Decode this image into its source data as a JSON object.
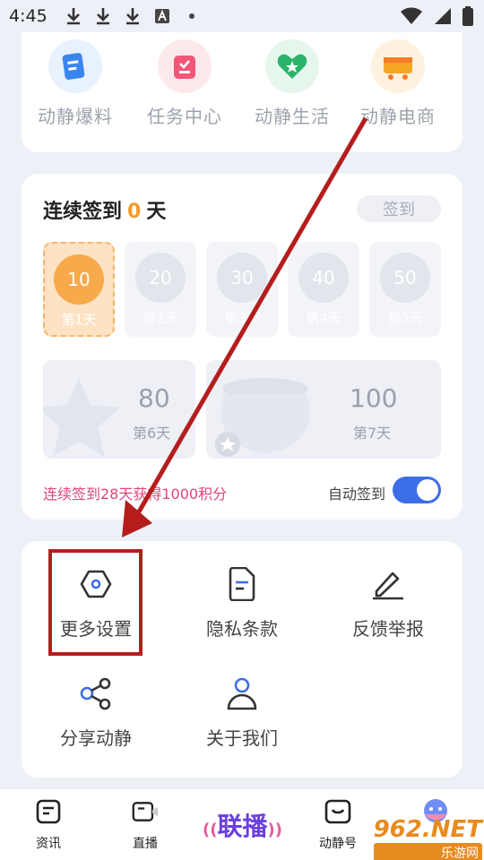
{
  "statusbar": {
    "time": "4:45"
  },
  "quick_entries": [
    {
      "label": "动静爆料",
      "icon": "news-doc-icon",
      "color": "#3a86f0",
      "bg": "#e8f2fe"
    },
    {
      "label": "任务中心",
      "icon": "task-board-icon",
      "color": "#f35677",
      "bg": "#fde9ec"
    },
    {
      "label": "动静生活",
      "icon": "heart-star-icon",
      "color": "#2bb36b",
      "bg": "#e5f7ec"
    },
    {
      "label": "动静电商",
      "icon": "shop-cart-icon",
      "color": "#f5a623",
      "bg": "#fff1df"
    }
  ],
  "checkin": {
    "title_prefix": "连续签到",
    "days_count": "0",
    "title_suffix": "天",
    "button_label": "签到",
    "days": [
      {
        "points": "10",
        "label": "第1天"
      },
      {
        "points": "20",
        "label": "第2天"
      },
      {
        "points": "30",
        "label": "第3天"
      },
      {
        "points": "40",
        "label": "第4天"
      },
      {
        "points": "50",
        "label": "第5天"
      }
    ],
    "big_days": [
      {
        "points": "80",
        "label": "第6天"
      },
      {
        "points": "100",
        "label": "第7天"
      }
    ],
    "promo": "连续签到28天获得1000积分",
    "auto_label": "自动签到",
    "auto_enabled": true
  },
  "menu": [
    {
      "label": "更多设置",
      "icon": "settings-hexagon-icon"
    },
    {
      "label": "隐私条款",
      "icon": "document-icon"
    },
    {
      "label": "反馈举报",
      "icon": "edit-pen-icon"
    },
    {
      "label": "分享动静",
      "icon": "share-icon"
    },
    {
      "label": "关于我们",
      "icon": "user-icon"
    }
  ],
  "bottom_nav": {
    "items": [
      {
        "label": "资讯",
        "icon": "news-icon"
      },
      {
        "label": "直播",
        "icon": "live-video-icon"
      },
      {
        "label": "动静号",
        "icon": "tv-smile-icon"
      }
    ],
    "center_logo": "联播"
  },
  "watermark": {
    "brand": "962.NET",
    "site": "乐游网"
  }
}
